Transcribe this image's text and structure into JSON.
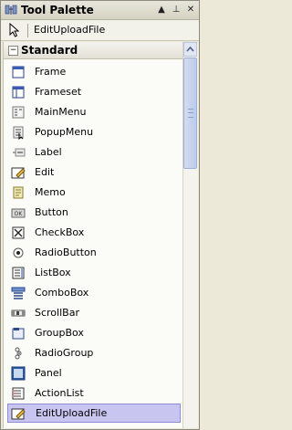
{
  "window": {
    "title": "Tool Palette",
    "buttons": {
      "dropdown": "▲",
      "pin": "⊥",
      "close": "✕"
    }
  },
  "filter": {
    "text": "EditUploadFile",
    "icon": "pointer-arrow-icon"
  },
  "category": {
    "label": "Standard",
    "toggle": "−"
  },
  "items": [
    {
      "label": "Frame",
      "icon": "frame-icon"
    },
    {
      "label": "Frameset",
      "icon": "frameset-icon"
    },
    {
      "label": "MainMenu",
      "icon": "mainmenu-icon"
    },
    {
      "label": "PopupMenu",
      "icon": "popupmenu-icon"
    },
    {
      "label": "Label",
      "icon": "label-icon"
    },
    {
      "label": "Edit",
      "icon": "edit-icon"
    },
    {
      "label": "Memo",
      "icon": "memo-icon"
    },
    {
      "label": "Button",
      "icon": "button-icon"
    },
    {
      "label": "CheckBox",
      "icon": "checkbox-icon"
    },
    {
      "label": "RadioButton",
      "icon": "radiobutton-icon"
    },
    {
      "label": "ListBox",
      "icon": "listbox-icon"
    },
    {
      "label": "ComboBox",
      "icon": "combobox-icon"
    },
    {
      "label": "ScrollBar",
      "icon": "scrollbar-icon"
    },
    {
      "label": "GroupBox",
      "icon": "groupbox-icon"
    },
    {
      "label": "RadioGroup",
      "icon": "radiogroup-icon"
    },
    {
      "label": "Panel",
      "icon": "panel-icon"
    },
    {
      "label": "ActionList",
      "icon": "actionlist-icon"
    },
    {
      "label": "EditUploadFile",
      "icon": "edituploadfile-icon",
      "selected": true
    }
  ],
  "colors": {
    "selection": "#c8c5f0",
    "selection_border": "#8e8ad6",
    "scroll_thumb": "#bccbea"
  }
}
